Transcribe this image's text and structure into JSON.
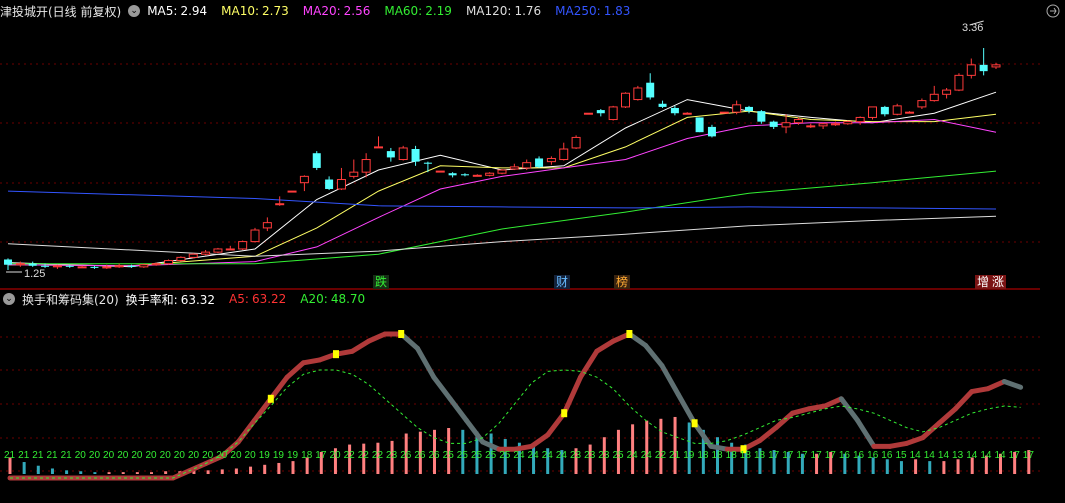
{
  "main_legend": {
    "title": "津投城开(日线 前复权)",
    "items": [
      {
        "label": "MA5:",
        "value": "2.94",
        "color": "#ffffff"
      },
      {
        "label": "MA10:",
        "value": "2.73",
        "color": "#ffff66"
      },
      {
        "label": "MA20:",
        "value": "2.56",
        "color": "#ff44ff"
      },
      {
        "label": "MA60:",
        "value": "2.19",
        "color": "#33ee33"
      },
      {
        "label": "MA120:",
        "value": "1.76",
        "color": "#dddddd"
      },
      {
        "label": "MA250:",
        "value": "1.83",
        "color": "#3355ff"
      }
    ]
  },
  "sub_legend": {
    "title": "换手和筹码集(20)",
    "items": [
      {
        "label": "换手率和:",
        "value": "63.32",
        "color": "#ffffff"
      },
      {
        "label": "A5:",
        "value": "63.22",
        "color": "#ff3333"
      },
      {
        "label": "A20:",
        "value": "48.70",
        "color": "#33ee33"
      }
    ]
  },
  "annotations": {
    "high": "3.36",
    "low": "1.25",
    "event_tags": [
      {
        "text": "跌",
        "color": "#33ee33",
        "bg": "#163016"
      },
      {
        "text": "财",
        "color": "#66bbff",
        "bg": "#14223a"
      },
      {
        "text": "榜",
        "color": "#ffaa33",
        "bg": "#3a2410"
      },
      {
        "text": "增",
        "color": "#ffffff",
        "bg": "#7a1414"
      },
      {
        "text": "涨",
        "color": "#ffffff",
        "bg": "#7a1414"
      }
    ]
  },
  "chart_data": [
    {
      "type": "candlestick",
      "title": "津投城开(日线 前复权)",
      "series_names": [
        "MA5",
        "MA10",
        "MA20",
        "MA60",
        "MA120",
        "MA250"
      ],
      "highest_marked": 3.36,
      "lowest_marked": 1.25,
      "candles": [
        [
          1.35,
          1.3,
          1.36,
          1.25
        ],
        [
          1.3,
          1.31,
          1.33,
          1.28
        ],
        [
          1.31,
          1.29,
          1.33,
          1.28
        ],
        [
          1.29,
          1.28,
          1.31,
          1.27
        ],
        [
          1.28,
          1.29,
          1.3,
          1.26
        ],
        [
          1.29,
          1.28,
          1.3,
          1.27
        ],
        [
          1.28,
          1.28,
          1.29,
          1.27
        ],
        [
          1.28,
          1.27,
          1.29,
          1.26
        ],
        [
          1.27,
          1.28,
          1.3,
          1.26
        ],
        [
          1.28,
          1.29,
          1.31,
          1.27
        ],
        [
          1.29,
          1.28,
          1.3,
          1.27
        ],
        [
          1.28,
          1.3,
          1.31,
          1.27
        ],
        [
          1.3,
          1.31,
          1.32,
          1.29
        ],
        [
          1.31,
          1.34,
          1.35,
          1.3
        ],
        [
          1.34,
          1.37,
          1.38,
          1.33
        ],
        [
          1.37,
          1.4,
          1.41,
          1.36
        ],
        [
          1.4,
          1.42,
          1.44,
          1.39
        ],
        [
          1.42,
          1.45,
          1.46,
          1.41
        ],
        [
          1.45,
          1.45,
          1.48,
          1.44
        ],
        [
          1.45,
          1.52,
          1.53,
          1.44
        ],
        [
          1.52,
          1.63,
          1.65,
          1.51
        ],
        [
          1.65,
          1.7,
          1.75,
          1.62
        ],
        [
          1.88,
          1.88,
          1.95,
          1.86
        ],
        [
          2.0,
          2.0,
          2.0,
          2.0
        ],
        [
          2.08,
          2.14,
          2.15,
          2.0
        ],
        [
          2.36,
          2.22,
          2.38,
          2.2
        ],
        [
          2.11,
          2.02,
          2.14,
          2.01
        ],
        [
          2.02,
          2.11,
          2.22,
          2.01
        ],
        [
          2.14,
          2.18,
          2.3,
          2.12
        ],
        [
          2.18,
          2.3,
          2.36,
          2.13
        ],
        [
          2.42,
          2.42,
          2.52,
          2.41
        ],
        [
          2.38,
          2.32,
          2.41,
          2.28
        ],
        [
          2.3,
          2.41,
          2.43,
          2.29
        ],
        [
          2.4,
          2.28,
          2.43,
          2.24
        ],
        [
          2.27,
          2.26,
          2.28,
          2.18
        ],
        [
          2.19,
          2.19,
          2.19,
          2.18
        ],
        [
          2.17,
          2.15,
          2.18,
          2.13
        ],
        [
          2.16,
          2.15,
          2.17,
          2.14
        ],
        [
          2.15,
          2.15,
          2.16,
          2.14
        ],
        [
          2.15,
          2.17,
          2.18,
          2.14
        ],
        [
          2.17,
          2.2,
          2.21,
          2.16
        ],
        [
          2.21,
          2.23,
          2.26,
          2.2
        ],
        [
          2.22,
          2.27,
          2.3,
          2.2
        ],
        [
          2.31,
          2.23,
          2.33,
          2.22
        ],
        [
          2.28,
          2.31,
          2.33,
          2.25
        ],
        [
          2.3,
          2.4,
          2.46,
          2.29
        ],
        [
          2.41,
          2.51,
          2.53,
          2.4
        ],
        [
          2.74,
          2.74,
          2.74,
          2.74
        ],
        [
          2.77,
          2.74,
          2.78,
          2.71
        ],
        [
          2.68,
          2.8,
          2.81,
          2.67
        ],
        [
          2.8,
          2.93,
          2.94,
          2.79
        ],
        [
          2.87,
          2.98,
          3.0,
          2.86
        ],
        [
          3.03,
          2.89,
          3.12,
          2.87
        ],
        [
          2.83,
          2.8,
          2.86,
          2.79
        ],
        [
          2.79,
          2.74,
          2.81,
          2.72
        ],
        [
          2.74,
          2.74,
          2.75,
          2.73
        ],
        [
          2.7,
          2.56,
          2.7,
          2.56
        ],
        [
          2.61,
          2.52,
          2.63,
          2.51
        ],
        [
          2.75,
          2.75,
          2.75,
          2.75
        ],
        [
          2.75,
          2.82,
          2.86,
          2.73
        ],
        [
          2.8,
          2.76,
          2.81,
          2.74
        ],
        [
          2.76,
          2.66,
          2.77,
          2.64
        ],
        [
          2.66,
          2.61,
          2.67,
          2.59
        ],
        [
          2.61,
          2.65,
          2.73,
          2.55
        ],
        [
          2.65,
          2.68,
          2.7,
          2.63
        ],
        [
          2.62,
          2.62,
          2.64,
          2.6
        ],
        [
          2.62,
          2.64,
          2.65,
          2.59
        ],
        [
          2.63,
          2.64,
          2.66,
          2.62
        ],
        [
          2.64,
          2.66,
          2.67,
          2.63
        ],
        [
          2.66,
          2.7,
          2.71,
          2.63
        ],
        [
          2.7,
          2.8,
          2.8,
          2.68
        ],
        [
          2.8,
          2.73,
          2.81,
          2.71
        ],
        [
          2.73,
          2.81,
          2.83,
          2.72
        ],
        [
          2.75,
          2.75,
          2.76,
          2.74
        ],
        [
          2.8,
          2.86,
          2.88,
          2.78
        ],
        [
          2.86,
          2.92,
          3.0,
          2.85
        ],
        [
          2.92,
          2.96,
          2.98,
          2.88
        ],
        [
          2.96,
          3.1,
          3.12,
          2.95
        ],
        [
          3.1,
          3.2,
          3.26,
          3.07
        ],
        [
          3.2,
          3.14,
          3.36,
          3.1
        ],
        [
          3.18,
          3.2,
          3.22,
          3.16
        ]
      ],
      "ma": {
        "MA5": [
          [
            0,
            1.32
          ],
          [
            10,
            1.28
          ],
          [
            20,
            1.45
          ],
          [
            25,
            1.92
          ],
          [
            30,
            2.2
          ],
          [
            35,
            2.34
          ],
          [
            40,
            2.2
          ],
          [
            45,
            2.24
          ],
          [
            50,
            2.6
          ],
          [
            55,
            2.87
          ],
          [
            60,
            2.76
          ],
          [
            65,
            2.7
          ],
          [
            70,
            2.65
          ],
          [
            75,
            2.74
          ],
          [
            80,
            2.94
          ]
        ],
        "MA10": [
          [
            0,
            1.3
          ],
          [
            10,
            1.29
          ],
          [
            20,
            1.38
          ],
          [
            25,
            1.65
          ],
          [
            30,
            2.0
          ],
          [
            35,
            2.24
          ],
          [
            40,
            2.22
          ],
          [
            45,
            2.22
          ],
          [
            50,
            2.42
          ],
          [
            55,
            2.7
          ],
          [
            60,
            2.76
          ],
          [
            65,
            2.68
          ],
          [
            70,
            2.66
          ],
          [
            75,
            2.66
          ],
          [
            80,
            2.73
          ]
        ],
        "MA20": [
          [
            0,
            1.3
          ],
          [
            10,
            1.29
          ],
          [
            20,
            1.33
          ],
          [
            25,
            1.47
          ],
          [
            30,
            1.75
          ],
          [
            35,
            2.02
          ],
          [
            40,
            2.14
          ],
          [
            45,
            2.22
          ],
          [
            50,
            2.3
          ],
          [
            55,
            2.5
          ],
          [
            60,
            2.62
          ],
          [
            65,
            2.65
          ],
          [
            70,
            2.65
          ],
          [
            75,
            2.68
          ],
          [
            80,
            2.56
          ]
        ],
        "MA60": [
          [
            0,
            1.31
          ],
          [
            20,
            1.31
          ],
          [
            30,
            1.4
          ],
          [
            40,
            1.64
          ],
          [
            50,
            1.8
          ],
          [
            60,
            1.98
          ],
          [
            70,
            2.08
          ],
          [
            80,
            2.19
          ]
        ],
        "MA120": [
          [
            0,
            1.5
          ],
          [
            20,
            1.38
          ],
          [
            30,
            1.43
          ],
          [
            40,
            1.52
          ],
          [
            50,
            1.59
          ],
          [
            60,
            1.67
          ],
          [
            70,
            1.72
          ],
          [
            80,
            1.76
          ]
        ],
        "MA250": [
          [
            0,
            2.0
          ],
          [
            20,
            1.93
          ],
          [
            30,
            1.86
          ],
          [
            40,
            1.85
          ],
          [
            50,
            1.84
          ],
          [
            60,
            1.85
          ],
          [
            70,
            1.84
          ],
          [
            80,
            1.83
          ]
        ]
      }
    },
    {
      "type": "bar",
      "title": "换手和筹码集(20)",
      "series_names": [
        "换手率和",
        "A5",
        "A20"
      ],
      "categories": [
        "21",
        "21",
        "21",
        "21",
        "21",
        "20",
        "20",
        "20",
        "20",
        "20",
        "20",
        "20",
        "20",
        "20",
        "20",
        "20",
        "20",
        "20",
        "19",
        "19",
        "19",
        "18",
        "17",
        "20",
        "22",
        "22",
        "22",
        "23",
        "26",
        "26",
        "26",
        "25",
        "25",
        "25",
        "25",
        "25",
        "24",
        "24",
        "24",
        "24",
        "23",
        "23",
        "23",
        "25",
        "24",
        "24",
        "22",
        "21",
        "19",
        "18",
        "18",
        "18",
        "18",
        "18",
        "17",
        "17",
        "17",
        "17",
        "17",
        "16",
        "16",
        "16",
        "16",
        "15",
        "14",
        "14",
        "14",
        "13",
        "14",
        "14",
        "14",
        "17",
        "17"
      ],
      "turnover": [
        18,
        13,
        9,
        6,
        4,
        3,
        2,
        2,
        2,
        2,
        2,
        3,
        3,
        4,
        4,
        5,
        6,
        8,
        10,
        12,
        14,
        18,
        24,
        28,
        32,
        33,
        34,
        36,
        44,
        46,
        48,
        50,
        48,
        46,
        44,
        38,
        34,
        30,
        28,
        26,
        28,
        32,
        40,
        48,
        54,
        58,
        60,
        62,
        56,
        48,
        40,
        34,
        32,
        28,
        26,
        24,
        22,
        22,
        24,
        22,
        20,
        18,
        16,
        14,
        16,
        14,
        14,
        16,
        18,
        20,
        22,
        24,
        26
      ],
      "a5": [
        0,
        0,
        0,
        0,
        0,
        0,
        0,
        0,
        0,
        0,
        0,
        5,
        10,
        15,
        25,
        40,
        55,
        70,
        80,
        82,
        86,
        88,
        95,
        100,
        100,
        90,
        70,
        55,
        40,
        25,
        20,
        20,
        22,
        30,
        45,
        70,
        88,
        95,
        100,
        92,
        78,
        58,
        38,
        22,
        20,
        20,
        26,
        35,
        45,
        48,
        50,
        55,
        40,
        22,
        22,
        24,
        28,
        38,
        48,
        60,
        62,
        67,
        63
      ],
      "a20": [
        0,
        0,
        0,
        0,
        0,
        0,
        0,
        0,
        0,
        0,
        0,
        5,
        10,
        16,
        25,
        38,
        50,
        63,
        72,
        75,
        75,
        72,
        65,
        55,
        45,
        35,
        28,
        24,
        24,
        28,
        38,
        52,
        66,
        74,
        75,
        74,
        70,
        62,
        50,
        40,
        32,
        28,
        24,
        24,
        26,
        30,
        35,
        40,
        42,
        45,
        48,
        50,
        48,
        45,
        40,
        35,
        32,
        35,
        40,
        45,
        48,
        50,
        49
      ]
    }
  ]
}
